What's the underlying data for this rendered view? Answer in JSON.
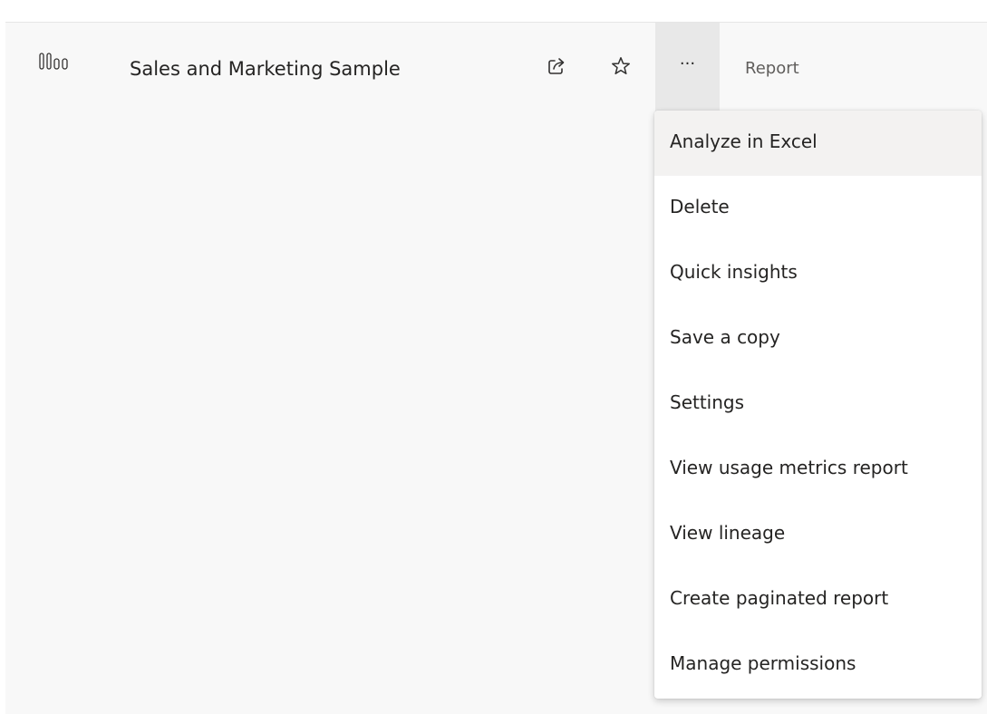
{
  "row": {
    "icon": "report-icon",
    "name": "Sales and Marketing Sample",
    "type": "Report",
    "actions": {
      "share_icon": "share-icon",
      "favorite_icon": "star-icon",
      "more_label": "···"
    }
  },
  "context_menu": {
    "items": [
      {
        "label": "Analyze in Excel",
        "highlighted": true
      },
      {
        "label": "Delete"
      },
      {
        "label": "Quick insights"
      },
      {
        "label": "Save a copy"
      },
      {
        "label": "Settings"
      },
      {
        "label": "View usage metrics report"
      },
      {
        "label": "View lineage"
      },
      {
        "label": "Create paginated report"
      },
      {
        "label": "Manage permissions"
      }
    ]
  },
  "colors": {
    "canvas": "#f8f8f8",
    "more_button_active": "#e8e8e8",
    "menu_highlight": "#f3f2f1",
    "text": "#252423",
    "secondary_text": "#605e5c"
  }
}
